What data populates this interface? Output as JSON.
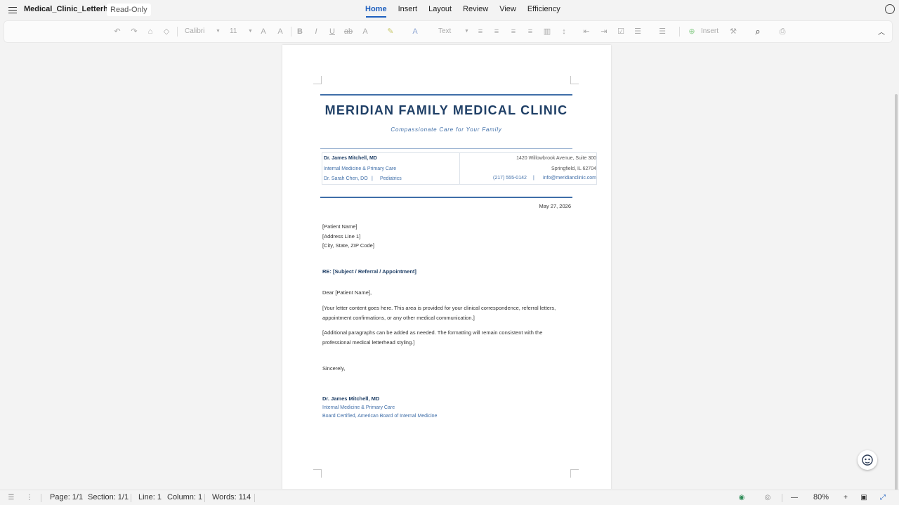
{
  "app": {
    "doc_title": "Medical_Clinic_Letterhead",
    "mode_badge": "Read-Only",
    "menu_tabs": [
      "Home",
      "Insert",
      "Layout",
      "Review",
      "View",
      "Efficiency"
    ],
    "active_tab": "Home"
  },
  "toolbar": {
    "font_name": "Calibri",
    "font_size": "11",
    "style_name": "Text",
    "insert_label": "Insert",
    "icons": [
      "undo-icon",
      "redo-icon",
      "format-painter-icon",
      "eraser-icon",
      "grow-font-icon",
      "shrink-font-icon",
      "bold-icon",
      "italic-icon",
      "underline-icon",
      "strikethrough-icon",
      "text-effects-icon",
      "highlight-icon",
      "font-color-icon",
      "align-left-icon",
      "align-center-icon",
      "align-right-icon",
      "justify-icon",
      "distributed-icon",
      "line-spacing-icon",
      "decrease-indent-icon",
      "increase-indent-icon",
      "checkbox-icon",
      "bullets-icon",
      "numbering-icon",
      "insert-icon",
      "tools-icon",
      "search-icon",
      "print-icon",
      "collapse-icon"
    ]
  },
  "letterhead": {
    "clinic_name": "MERIDIAN FAMILY MEDICAL CLINIC",
    "tagline": "Compassionate Care for Your Family",
    "doctor_primary": "Dr. James Mitchell, MD",
    "specialty_primary": "Internal Medicine & Primary Care",
    "doctor_secondary": "Dr. Sarah Chen, DO",
    "specialty_secondary": "Pediatrics",
    "separator": "|",
    "address_line1": "1420 Willowbrook Avenue, Suite 300",
    "address_line2": "Springfield, IL 62704",
    "phone": "(217) 555-0142",
    "email": "info@meridianclinic.com"
  },
  "letter": {
    "date": "May 27, 2026",
    "recipient": [
      "[Patient Name]",
      "[Address Line 1]",
      "[City, State, ZIP Code]"
    ],
    "re_line": "RE: [Subject / Referral / Appointment]",
    "salutation": "Dear [Patient Name],",
    "paragraph1": [
      "[Your letter content goes here. This area is provided for your clinical correspondence, referral letters,",
      "appointment confirmations, or any other medical communication.]"
    ],
    "paragraph2": [
      "[Additional paragraphs can be added as needed. The formatting will remain consistent with the",
      "professional medical letterhead styling.]"
    ],
    "closing": "Sincerely,",
    "signature_name": "Dr. James Mitchell, MD",
    "signature_title": "Internal Medicine & Primary Care",
    "signature_cert": "Board Certified, American Board of Internal Medicine"
  },
  "status": {
    "page": "Page: 1/1",
    "section": "Section: 1/1",
    "line": "Line: 1",
    "column": "Column: 1",
    "words": "Words: 114",
    "zoom": "80%"
  },
  "colors": {
    "accent_blue": "#1d5fbf",
    "navy": "#1f3f66",
    "letterhead_blue": "#3f6ea8"
  }
}
